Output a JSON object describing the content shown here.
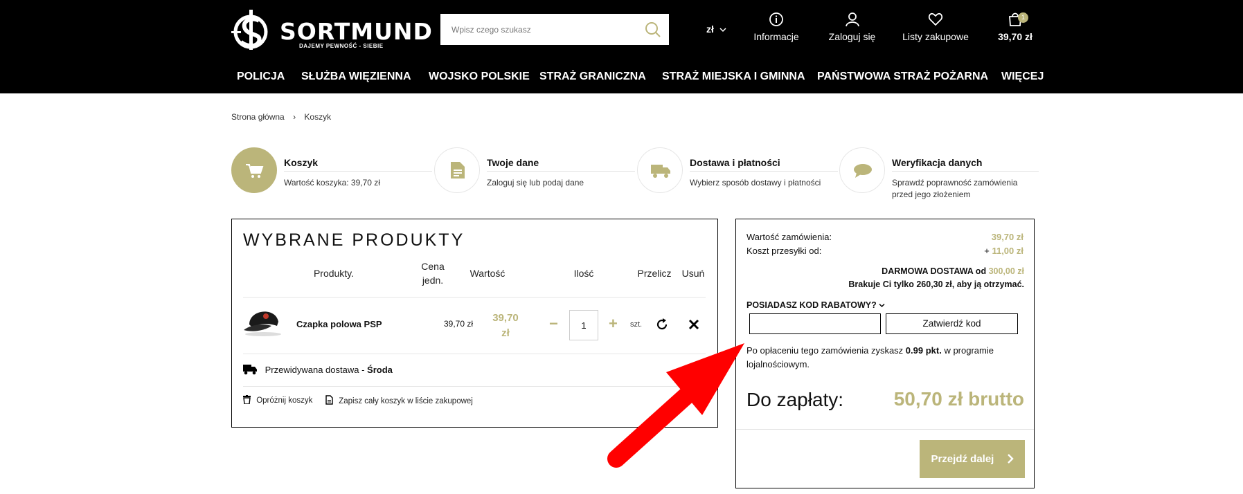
{
  "header": {
    "brand": "SORTMUND",
    "tagline": "DAJEMY PEWNOŚĆ - SIEBIE",
    "search_placeholder": "Wpisz czego szukasz",
    "currency": "zł",
    "items": [
      {
        "label": "Informacje",
        "icon": "info-icon"
      },
      {
        "label": "Zaloguj się",
        "icon": "user-icon"
      },
      {
        "label": "Listy zakupowe",
        "icon": "heart-icon"
      },
      {
        "label": "39,70 zł",
        "icon": "cart-bag-icon",
        "badge": "1"
      }
    ]
  },
  "nav": [
    "POLICJA",
    "SŁUŻBA WIĘZIENNA",
    "WOJSKO POLSKIE",
    "STRAŻ GRANICZNA",
    "STRAŻ MIEJSKA I GMINNA",
    "PAŃSTWOWA STRAŻ POŻARNA",
    "WIĘCEJ"
  ],
  "breadcrumb": {
    "home": "Strona główna",
    "sep": "›",
    "current": "Koszyk"
  },
  "steps": [
    {
      "title": "Koszyk",
      "sub": "Wartość koszyka: 39,70 zł",
      "icon": "cart-icon"
    },
    {
      "title": "Twoje dane",
      "sub": "Zaloguj się lub podaj dane",
      "icon": "document-icon"
    },
    {
      "title": "Dostawa i płatności",
      "sub": "Wybierz sposób dostawy i płatności",
      "icon": "truck-icon"
    },
    {
      "title": "Weryfikacja danych",
      "sub": "Sprawdź poprawność zamówienia",
      "sub2": "przed jego złożeniem",
      "icon": "chat-icon"
    }
  ],
  "products": {
    "title": "WYBRANE PRODUKTY",
    "cols": {
      "product": "Produkty.",
      "unit1": "Cena",
      "unit2": "jedn.",
      "value": "Wartość",
      "qty": "Ilość",
      "recalc": "Przelicz",
      "remove": "Usuń"
    },
    "item": {
      "name": "Czapka polowa PSP",
      "unit_price": "39,70 zł",
      "value1": "39,70",
      "value2": "zł",
      "qty": "1",
      "unit": "szt."
    },
    "delivery_label": "Przewidywana dostawa - ",
    "delivery_day": "Środa",
    "empty_cart": "Opróżnij koszyk",
    "save_cart": "Zapisz cały koszyk w liście zakupowej"
  },
  "summary": {
    "order_value_label": "Wartość zamówienia:",
    "order_value": "39,70 zł",
    "shipping_label": "Koszt przesyłki od:",
    "shipping_prefix": "+ ",
    "shipping_value": "11,00 zł",
    "free_label": "DARMOWA DOSTAWA od ",
    "free_value": "300,00 zł",
    "missing": "Brakuje Ci tylko 260,30 zł, aby ją otrzymać.",
    "discount_label": "POSIADASZ KOD RABATOWY?",
    "discount_placeholder": "",
    "discount_button": "Zatwierdź kod",
    "loyalty_pre": "Po opłaceniu tego zamówienia zyskasz ",
    "loyalty_pts": "0.99 pkt.",
    "loyalty_post": " w programie",
    "loyalty_line2": "lojalnościowym.",
    "pay_label": "Do zapłaty:",
    "pay_value": "50,70 zł brutto",
    "next_button": "Przejdź dalej"
  },
  "colors": {
    "accent": "#bbb57a",
    "black": "#000000",
    "annotation_arrow": "#ff0000"
  }
}
